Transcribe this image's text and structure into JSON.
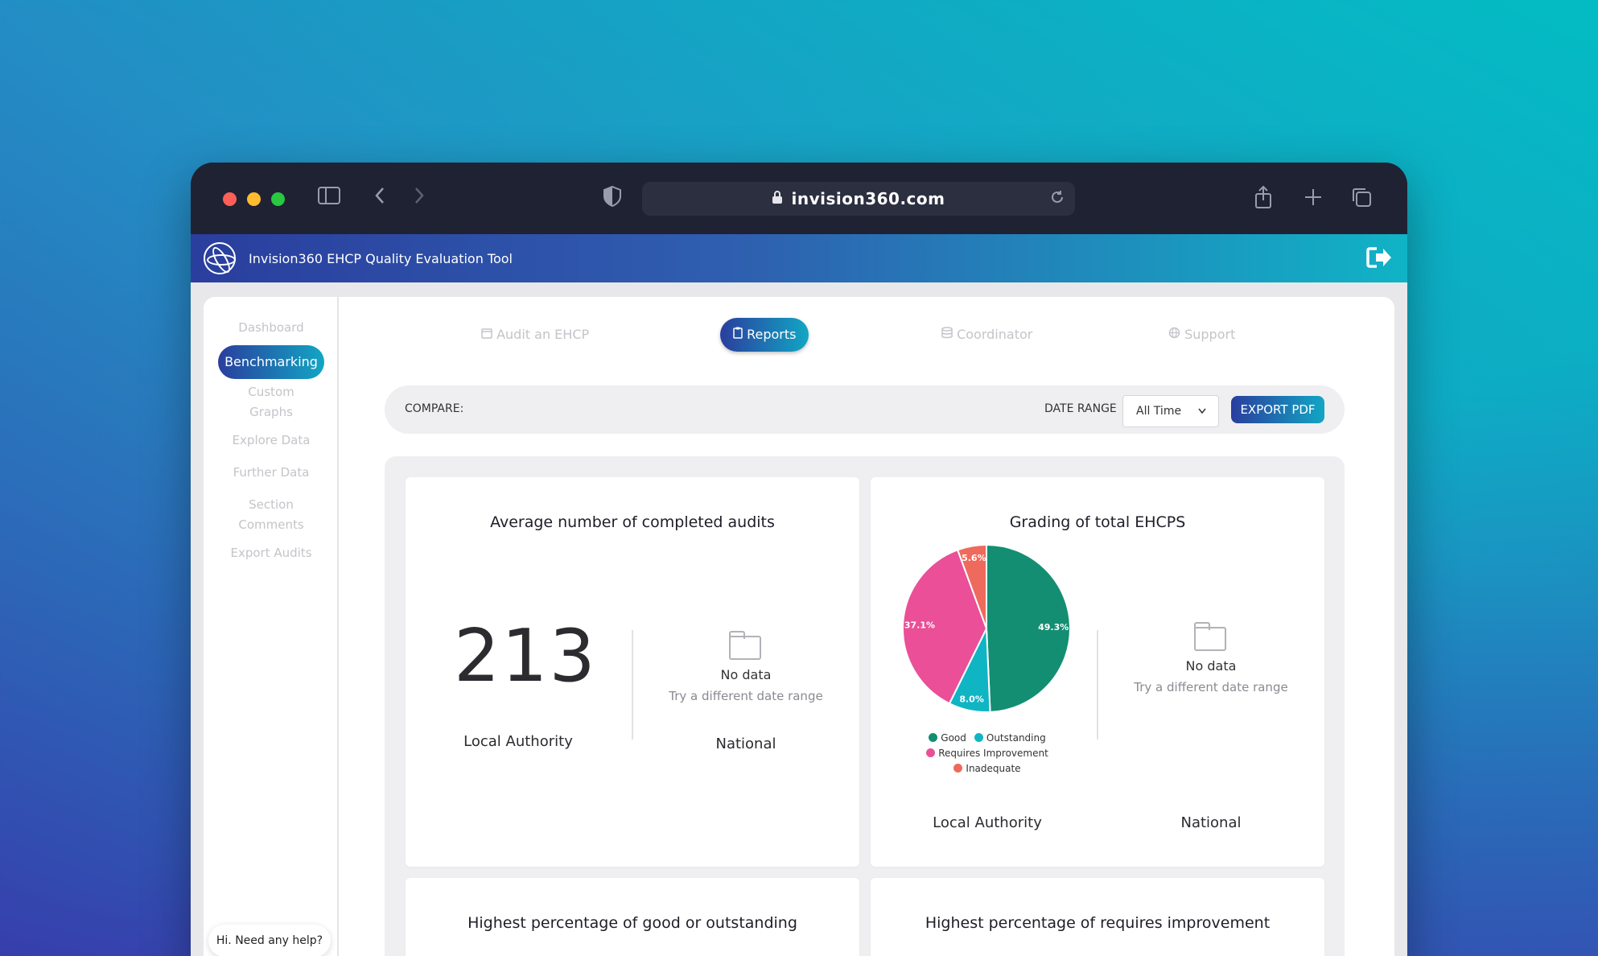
{
  "browser": {
    "url": "invision360.com"
  },
  "app": {
    "title": "Invision360 EHCP Quality Evaluation Tool"
  },
  "sidebar": {
    "items": [
      {
        "label": "Dashboard"
      },
      {
        "label": "Benchmarking"
      },
      {
        "label": "Custom Graphs"
      },
      {
        "label": "Explore Data"
      },
      {
        "label": "Further Data"
      },
      {
        "label": "Section Comments"
      },
      {
        "label": "Export Audits"
      }
    ],
    "help": "Hi. Need any help?"
  },
  "topnav": {
    "audit": "Audit an EHCP",
    "reports": "Reports",
    "coordinator": "Coordinator",
    "support": "Support"
  },
  "filters": {
    "compare_label": "COMPARE:",
    "date_range_label": "DATE RANGE",
    "date_range_value": "All Time",
    "export_label": "EXPORT PDF"
  },
  "cards": {
    "audits": {
      "title": "Average number of completed audits",
      "value": "213",
      "local_label": "Local Authority",
      "national_label": "National",
      "no_data": "No data",
      "no_data_hint": "Try a different date range"
    },
    "grading": {
      "title": "Grading of total EHCPS",
      "local_label": "Local Authority",
      "national_label": "National",
      "no_data": "No data",
      "no_data_hint": "Try a different date range"
    },
    "good_outstanding": {
      "title": "Highest percentage of good or outstanding"
    },
    "requires_improvement": {
      "title": "Highest percentage of requires improvement"
    }
  },
  "chart_data": {
    "type": "pie",
    "title": "Grading of total EHCPS",
    "categories": [
      "Good",
      "Outstanding",
      "Requires Improvement",
      "Inadequate"
    ],
    "values": [
      49.3,
      8.0,
      37.1,
      5.6
    ],
    "colors": [
      "#138e72",
      "#10b5c4",
      "#ea4f98",
      "#ee6a5c"
    ],
    "labels": [
      "49.3%",
      "8.0%",
      "37.1%",
      "5.6%"
    ],
    "legend": "bottom"
  }
}
